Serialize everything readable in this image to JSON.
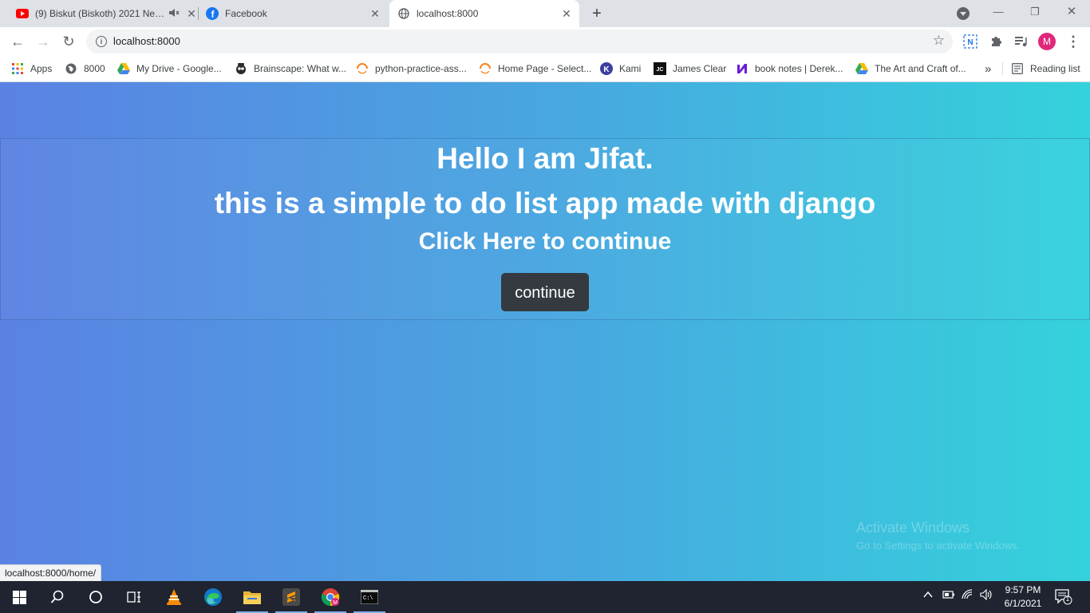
{
  "tabs": [
    {
      "title": "(9) Biskut (Biskoth) 2021 Ne…",
      "close": "✕"
    },
    {
      "title": "Facebook",
      "close": "✕"
    },
    {
      "title": "localhost:8000",
      "close": "✕"
    }
  ],
  "tabstrip": {
    "new_tab": "+"
  },
  "window_controls": {
    "minimize": "—",
    "restore": "❐",
    "close": "✕"
  },
  "toolbar": {
    "back": "←",
    "forward": "→",
    "reload": "↻",
    "url": "localhost:8000",
    "info": "i",
    "star": "☆",
    "avatar_letter": "M",
    "menu": "⋮"
  },
  "bookmarks": [
    {
      "label": "Apps",
      "icon": "apps-grid-icon"
    },
    {
      "label": "8000",
      "icon": "globe-icon"
    },
    {
      "label": "My Drive - Google...",
      "icon": "google-drive-icon"
    },
    {
      "label": "Brainscape: What w...",
      "icon": "brainscape-icon"
    },
    {
      "label": "python-practice-ass...",
      "icon": "spinner-icon"
    },
    {
      "label": "Home Page - Select...",
      "icon": "spinner-icon"
    },
    {
      "label": "Kami",
      "icon": "kami-icon"
    },
    {
      "label": "James Clear",
      "icon": "jc-icon"
    },
    {
      "label": "book notes | Derek...",
      "icon": "derek-icon"
    },
    {
      "label": "The Art and Craft of...",
      "icon": "google-drive-icon"
    }
  ],
  "bookmarks_overflow": "»",
  "reading_list": "Reading list",
  "page": {
    "heading": "Hello I am Jifat.",
    "subheading": "this is a simple to do list app made with django",
    "prompt": "Click Here to continue",
    "button_label": "continue",
    "status_url": "localhost:8000/home/"
  },
  "watermark": {
    "line1": "Activate Windows",
    "line2": "Go to Settings to activate Windows."
  },
  "clock": {
    "time": "9:57 PM",
    "date": "6/1/2021"
  },
  "notification_count": "1",
  "colors": {
    "gradient_start": "#5b82e3",
    "gradient_end": "#34d2dc",
    "button_bg": "#343a40",
    "taskbar": "#1f2430"
  }
}
